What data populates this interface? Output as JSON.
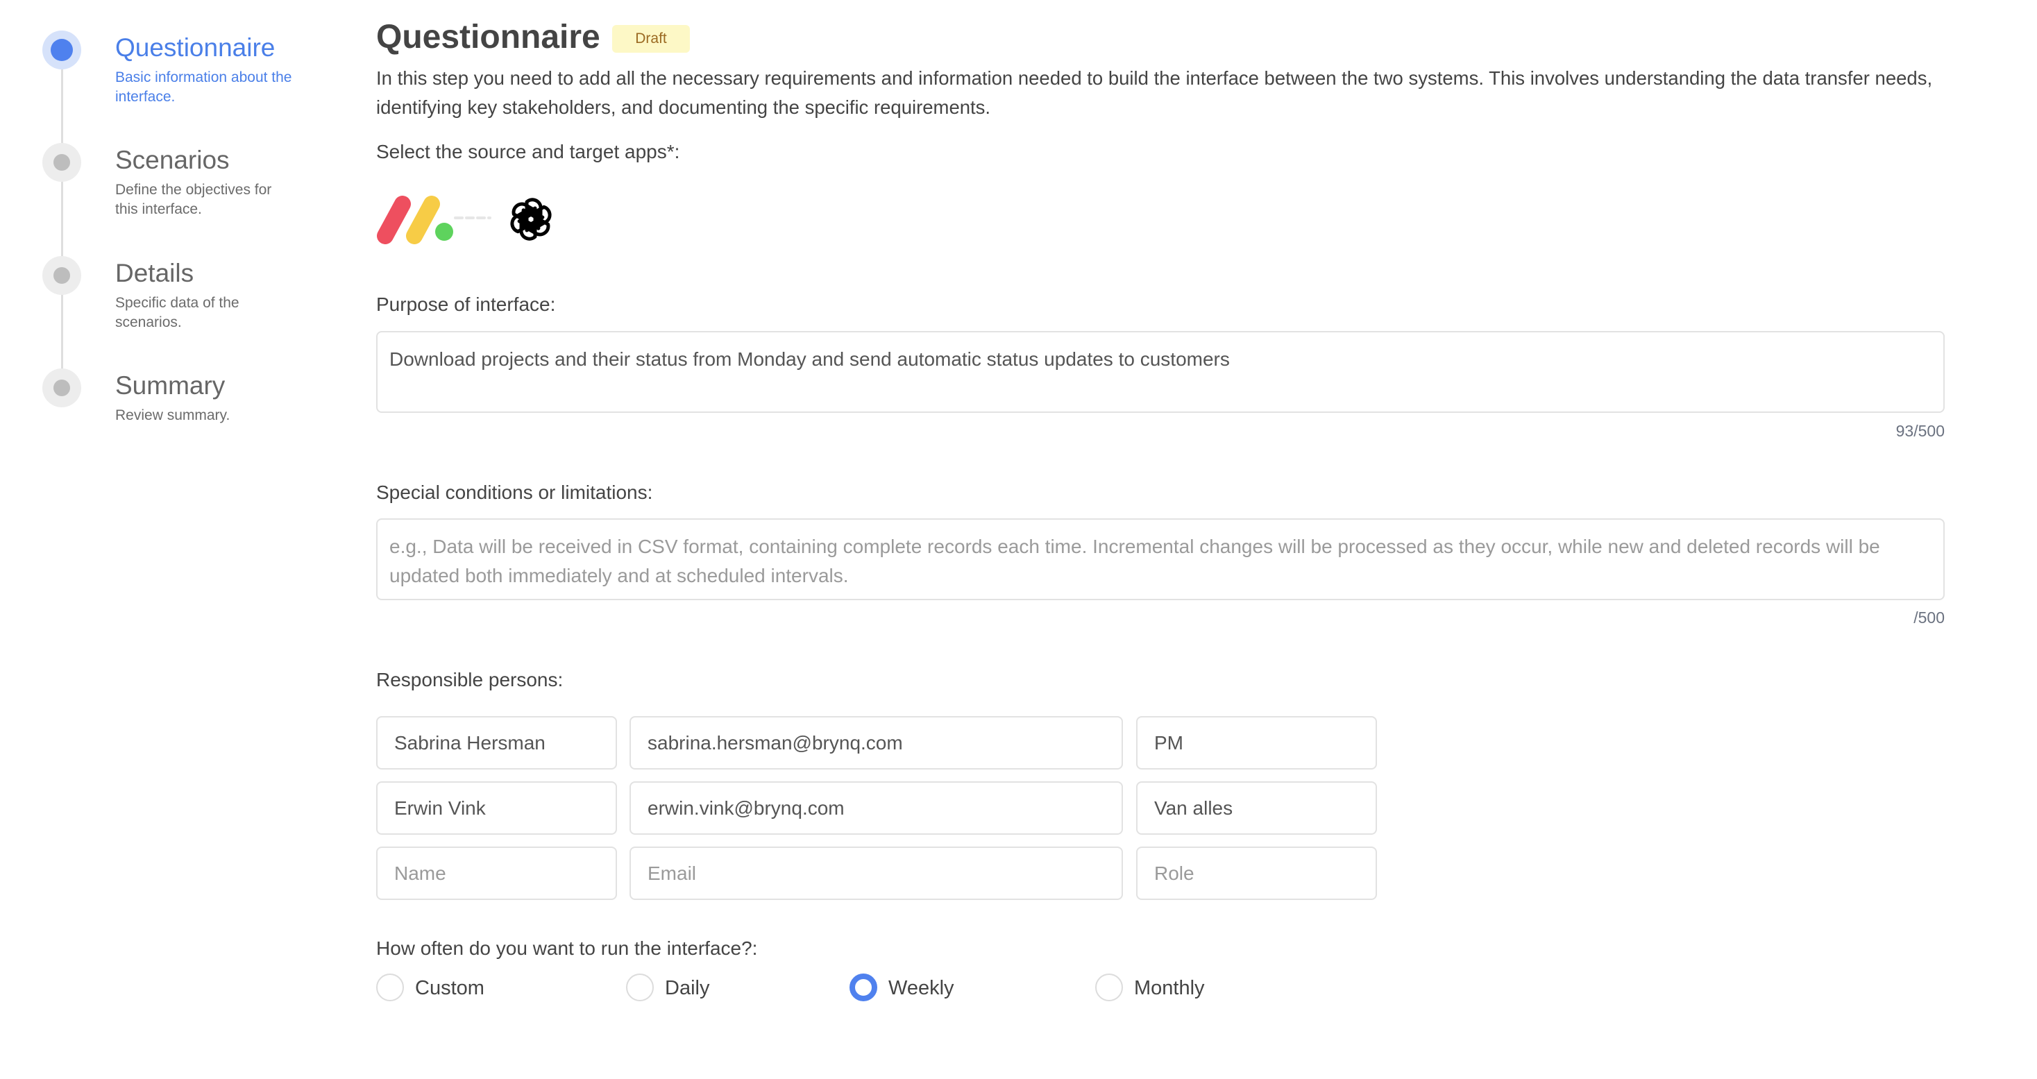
{
  "stepper": {
    "steps": [
      {
        "title": "Questionnaire",
        "subtitle": "Basic information about the interface.",
        "active": true
      },
      {
        "title": "Scenarios",
        "subtitle": "Define the objectives for this interface.",
        "active": false
      },
      {
        "title": "Details",
        "subtitle": "Specific data of the scenarios.",
        "active": false
      },
      {
        "title": "Summary",
        "subtitle": "Review summary.",
        "active": false
      }
    ]
  },
  "header": {
    "title": "Questionnaire",
    "badge": "Draft",
    "description": "In this step you need to add all the necessary requirements and information needed to build the interface between the two systems. This involves understanding the data transfer needs, identifying key stakeholders, and documenting the specific requirements."
  },
  "apps": {
    "label": "Select the source and target apps*:",
    "source": {
      "name": "Monday",
      "icon": "monday-logo-icon",
      "colors": [
        "#ee4f5f",
        "#f7cc46",
        "#5ed35d"
      ]
    },
    "target": {
      "name": "OpenAI",
      "icon": "openai-logo-icon",
      "color": "#000000"
    }
  },
  "purpose": {
    "label": "Purpose of interface:",
    "value": "Download projects and their status from Monday and send automatic status updates to customers",
    "counter": "93/500"
  },
  "conditions": {
    "label": "Special conditions or limitations:",
    "placeholder": "e.g., Data will be received in CSV format, containing complete records each time. Incremental changes will be processed as they occur, while new and deleted records will be updated both immediately and at scheduled intervals.",
    "counter": "/500"
  },
  "persons": {
    "label": "Responsible persons:",
    "rows": [
      {
        "name": "Sabrina Hersman",
        "email": "sabrina.hersman@brynq.com",
        "role": "PM"
      },
      {
        "name": "Erwin Vink",
        "email": "erwin.vink@brynq.com",
        "role": "Van alles"
      }
    ],
    "placeholders": {
      "name": "Name",
      "email": "Email",
      "role": "Role"
    }
  },
  "frequency": {
    "label": "How often do you want to run the interface?:",
    "options": [
      "Custom",
      "Daily",
      "Weekly",
      "Monthly"
    ],
    "selected": "Weekly",
    "accent": "#4f81ee"
  }
}
